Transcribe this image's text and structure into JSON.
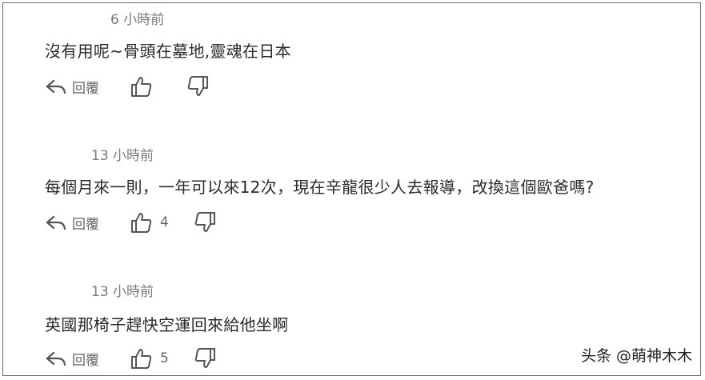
{
  "comments": [
    {
      "time": "6 小時前",
      "text": "沒有用呢~骨頭在墓地,靈魂在日本",
      "reply_label": "回覆",
      "likes": ""
    },
    {
      "time": "13 小時前",
      "text": "每個月來一則，一年可以來12次，現在辛龍很少人去報導，改換這個歐爸嗎?",
      "reply_label": "回覆",
      "likes": "4"
    },
    {
      "time": "13 小時前",
      "text": "英國那椅子趕快空運回來給他坐啊",
      "reply_label": "回覆",
      "likes": "5"
    }
  ],
  "watermark": "头条 @萌神木木",
  "icons": {
    "reply": "reply-arrow-icon",
    "like": "thumbs-up-icon",
    "dislike": "thumbs-down-icon"
  },
  "colors": {
    "text": "#2a2a2a",
    "meta": "#7a7a7a",
    "icon": "#555555",
    "border": "#6a6a6a"
  }
}
